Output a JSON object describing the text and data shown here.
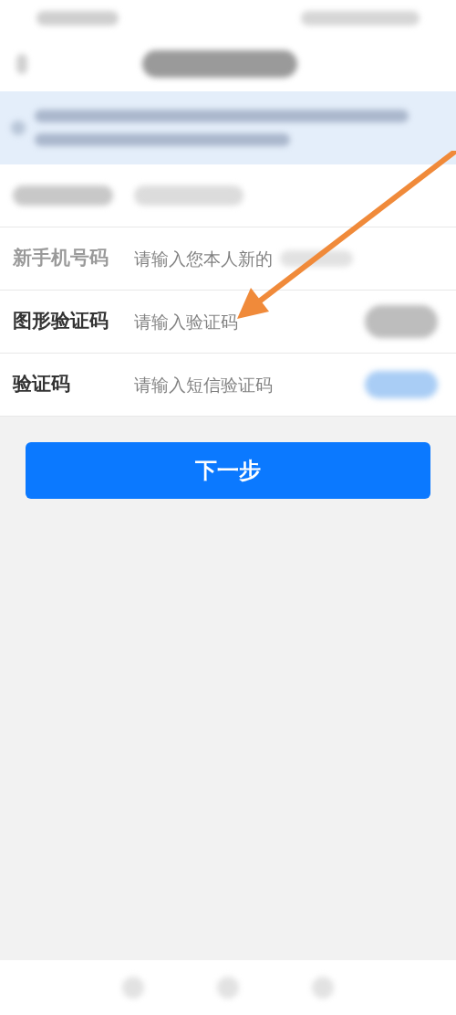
{
  "form": {
    "rows": [
      {
        "kind": "current"
      },
      {
        "kind": "new_phone",
        "label": "新手机号码",
        "placeholder": "请输入您本人新的"
      },
      {
        "kind": "captcha",
        "label": "图形验证码",
        "placeholder": "请输入验证码"
      },
      {
        "kind": "sms",
        "label": "验证码",
        "placeholder": "请输入短信验证码"
      }
    ]
  },
  "next_button": {
    "label": "下一步"
  }
}
